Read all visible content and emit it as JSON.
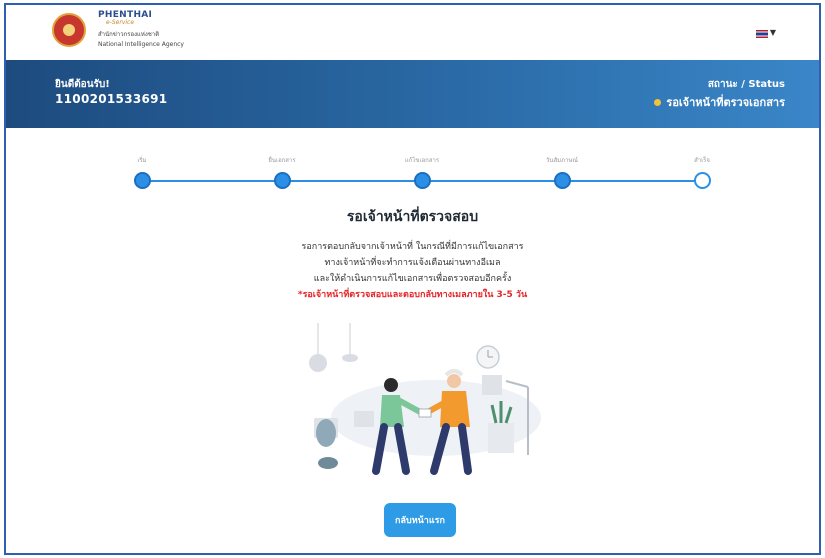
{
  "header": {
    "brand_name": "PHENTHAI",
    "brand_sub": "e-Service",
    "org_thai": "สำนักข่าวกรองแห่งชาติ",
    "org_en": "National Intelligence Agency",
    "language_icon": "thai-flag-icon"
  },
  "banner": {
    "welcome": "ยินดีต้อนรับ!",
    "user_id": "1100201533691",
    "status_label": "สถานะ / Status",
    "status_value": "รอเจ้าหน้าที่ตรวจเอกสาร",
    "status_color": "#f2c23b"
  },
  "stepper": {
    "steps": [
      {
        "label": "เริ่ม",
        "state": "done"
      },
      {
        "label": "ยื่นเอกสาร",
        "state": "done"
      },
      {
        "label": "แก้ไขเอกสาร",
        "state": "done"
      },
      {
        "label": "วันสัมภาษณ์",
        "state": "done"
      },
      {
        "label": "สำเร็จ",
        "state": "pending"
      }
    ],
    "accent": "#2c8fe6"
  },
  "main": {
    "title": "รอเจ้าหน้าที่ตรวจสอบ",
    "desc_lines": [
      "รอการตอบกลับจากเจ้าหน้าที่ ในกรณีที่มีการแก้ไขเอกสาร",
      "ทางเจ้าหน้าที่จะทำการแจ้งเตือนผ่านทางอีเมล",
      "และให้ดำเนินการแก้ไขเอกสารเพื่อตรวจสอบอีกครั้ง"
    ],
    "note": "*รอเจ้าหน้าที่ตรวจสอบและตอบกลับทางเมลภายใน 3-5 วัน",
    "note_color": "#e3262b",
    "home_button": "กลับหน้าแรก"
  }
}
